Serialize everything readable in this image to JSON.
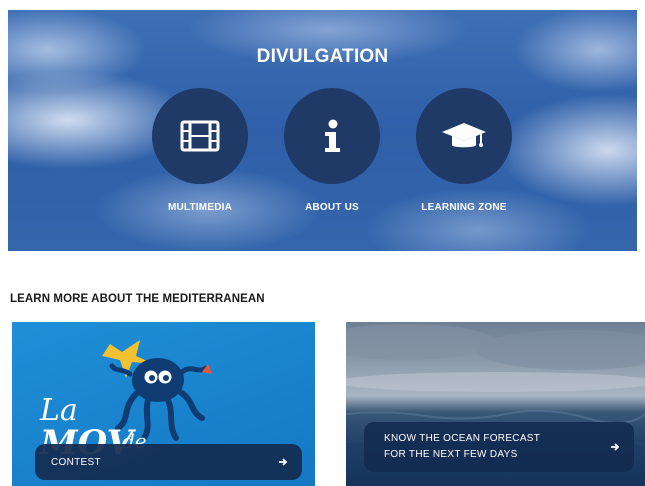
{
  "hero": {
    "title": "DIVULGATION",
    "items": [
      {
        "label": "MULTIMEDIA",
        "icon": "film-icon"
      },
      {
        "label": "ABOUT US",
        "icon": "info-icon"
      },
      {
        "label": "LEARNING ZONE",
        "icon": "graduation-cap-icon"
      }
    ]
  },
  "section": {
    "title": "LEARN MORE ABOUT THE MEDITERRANEAN"
  },
  "cards": [
    {
      "label": "CONTEST",
      "art_text": "La MOVde"
    },
    {
      "label": "KNOW THE OCEAN FORECAST\nFOR THE NEXT FEW DAYS"
    }
  ],
  "colors": {
    "hero_circle": "#1f3a66",
    "pill_bg": "#142b50",
    "contest_card": "#1a85cf"
  }
}
